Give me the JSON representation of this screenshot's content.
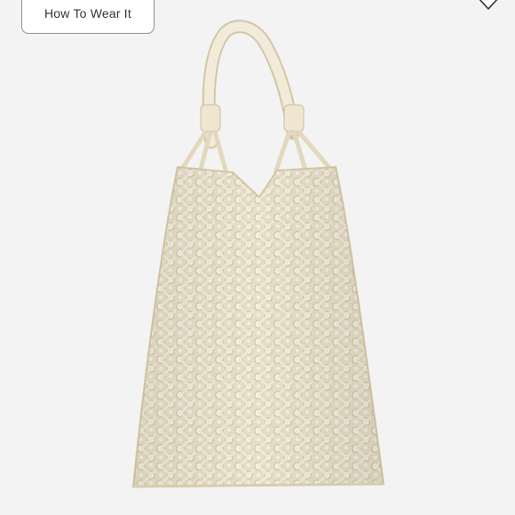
{
  "header": {
    "how_to_wear_label": "How To Wear It",
    "corner_icon": "heart-icon"
  },
  "product": {
    "image_icon": "macrame-tote-bag-image",
    "colors": {
      "background": "#f3f3f3",
      "bag": "#ece4cf",
      "bag_shadow": "#d4c7a6"
    }
  }
}
